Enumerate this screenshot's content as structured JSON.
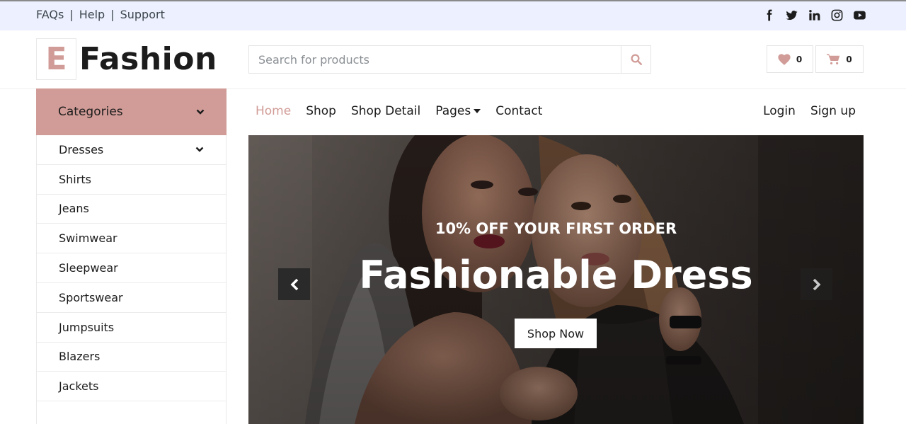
{
  "topbar": {
    "links": [
      "FAQs",
      "Help",
      "Support"
    ],
    "social_icons": [
      "facebook-icon",
      "twitter-icon",
      "linkedin-icon",
      "instagram-icon",
      "youtube-icon"
    ]
  },
  "header": {
    "logo_letter": "E",
    "logo_text": "Fashion",
    "search_placeholder": "Search for products",
    "wishlist_count": "0",
    "cart_count": "0"
  },
  "sidebar": {
    "title": "Categories",
    "items": [
      {
        "label": "Dresses",
        "has_dropdown": true
      },
      {
        "label": "Shirts"
      },
      {
        "label": "Jeans"
      },
      {
        "label": "Swimwear"
      },
      {
        "label": "Sleepwear"
      },
      {
        "label": "Sportswear"
      },
      {
        "label": "Jumpsuits"
      },
      {
        "label": "Blazers"
      },
      {
        "label": "Jackets"
      }
    ]
  },
  "nav": {
    "home": "Home",
    "shop": "Shop",
    "shop_detail": "Shop Detail",
    "pages": "Pages",
    "contact": "Contact",
    "login": "Login",
    "signup": "Sign up"
  },
  "hero": {
    "subtitle": "10% OFF YOUR FIRST ORDER",
    "title": "Fashionable Dress",
    "button": "Shop Now"
  },
  "colors": {
    "accent": "#d19c97",
    "topbar_bg": "#edf1ff",
    "text": "#1c1c1c"
  }
}
